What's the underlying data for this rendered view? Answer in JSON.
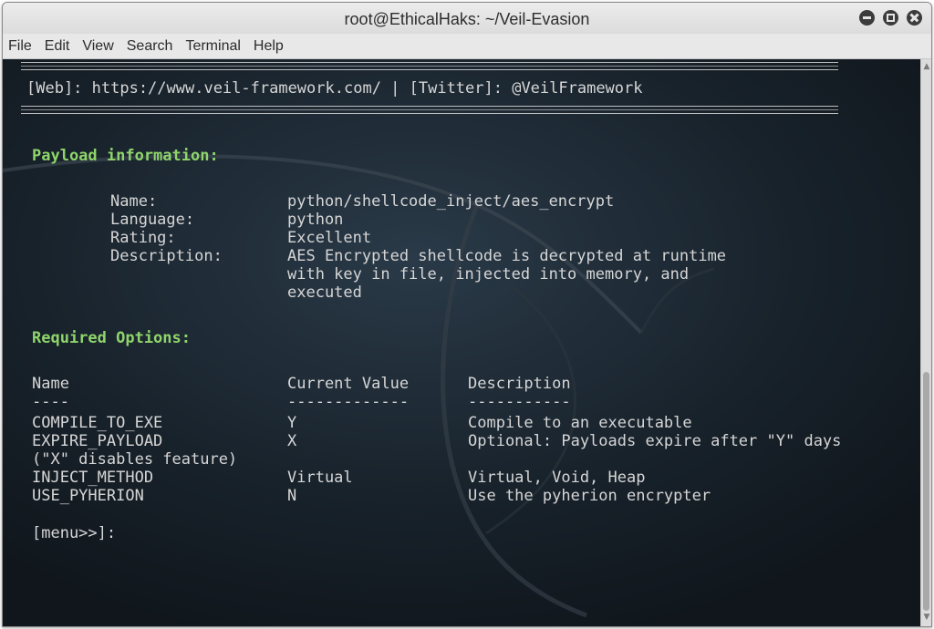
{
  "window": {
    "title": "root@EthicalHaks: ~/Veil-Evasion"
  },
  "menubar": {
    "items": [
      "File",
      "Edit",
      "View",
      "Search",
      "Terminal",
      "Help"
    ]
  },
  "terminal": {
    "banner": {
      "rule": "================================================================",
      "web_label": "[Web]: https://www.veil-framework.com/ | [Twitter]: @VeilFramework"
    },
    "payload_info": {
      "heading": "Payload information:",
      "rows": [
        {
          "key": "Name:",
          "value": "python/shellcode_inject/aes_encrypt"
        },
        {
          "key": "Language:",
          "value": "python"
        },
        {
          "key": "Rating:",
          "value": "Excellent"
        },
        {
          "key": "Description:",
          "value": "AES Encrypted shellcode is decrypted at runtime"
        }
      ],
      "description_cont": [
        "with key in file, injected into memory, and",
        "executed"
      ]
    },
    "required_options": {
      "heading": "Required Options:",
      "columns": [
        "Name",
        "Current Value",
        "Description"
      ],
      "underlines": [
        "----",
        "-------------",
        "-----------"
      ],
      "rows": [
        {
          "name": "COMPILE_TO_EXE",
          "value": "Y",
          "description": "Compile to an executable"
        },
        {
          "name": "EXPIRE_PAYLOAD",
          "value": "X",
          "description": "Optional: Payloads expire after \"Y\" days"
        },
        {
          "name": "(\"X\" disables feature)",
          "value": "",
          "description": ""
        },
        {
          "name": "INJECT_METHOD",
          "value": "Virtual",
          "description": "Virtual, Void, Heap"
        },
        {
          "name": "USE_PYHERION",
          "value": "N",
          "description": "Use the pyherion encrypter"
        }
      ]
    },
    "prompt": "[menu>>]:"
  },
  "colors": {
    "terminal_bg": "#141a20",
    "text": "#d6d6d6",
    "heading": "#8fd56b"
  },
  "icons": {
    "minimize": "minimize-icon",
    "maximize": "maximize-icon",
    "close": "close-icon",
    "background": "kali-dragon-icon"
  }
}
